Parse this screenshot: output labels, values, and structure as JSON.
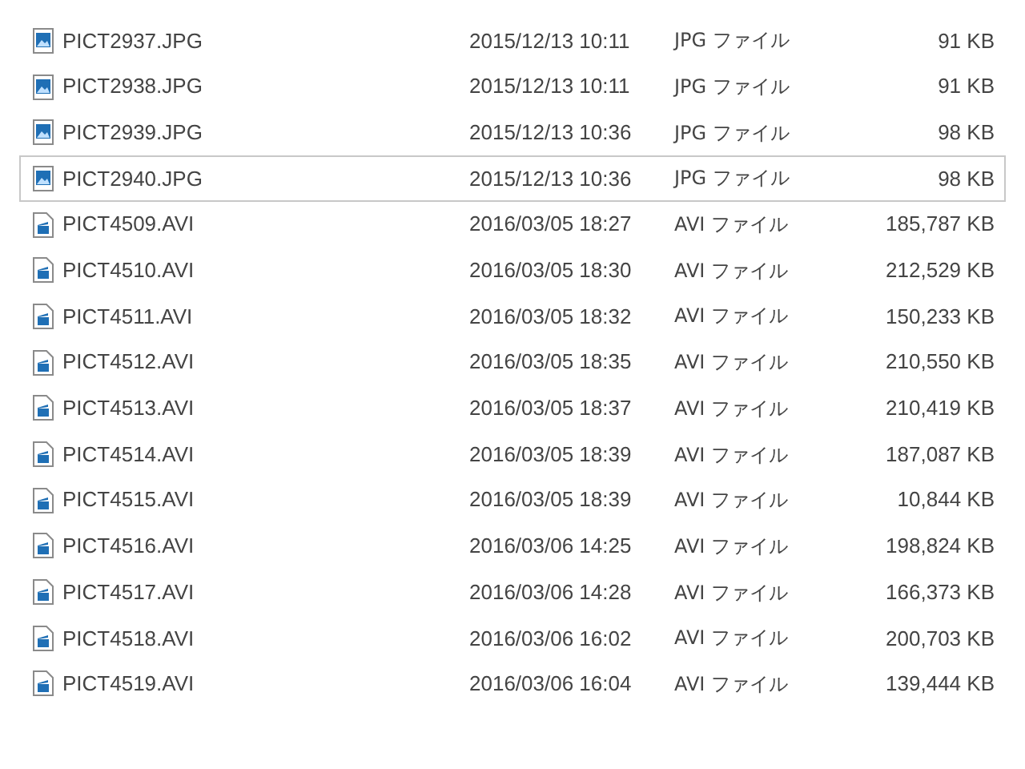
{
  "files": [
    {
      "kind": "image",
      "name": "PICT2937.JPG",
      "date": "2015/12/13 10:11",
      "type": "JPG ファイル",
      "size": "91 KB",
      "selected": false
    },
    {
      "kind": "image",
      "name": "PICT2938.JPG",
      "date": "2015/12/13 10:11",
      "type": "JPG ファイル",
      "size": "91 KB",
      "selected": false
    },
    {
      "kind": "image",
      "name": "PICT2939.JPG",
      "date": "2015/12/13 10:36",
      "type": "JPG ファイル",
      "size": "98 KB",
      "selected": false
    },
    {
      "kind": "image",
      "name": "PICT2940.JPG",
      "date": "2015/12/13 10:36",
      "type": "JPG ファイル",
      "size": "98 KB",
      "selected": true
    },
    {
      "kind": "video",
      "name": "PICT4509.AVI",
      "date": "2016/03/05 18:27",
      "type": "AVI ファイル",
      "size": "185,787 KB",
      "selected": false
    },
    {
      "kind": "video",
      "name": "PICT4510.AVI",
      "date": "2016/03/05 18:30",
      "type": "AVI ファイル",
      "size": "212,529 KB",
      "selected": false
    },
    {
      "kind": "video",
      "name": "PICT4511.AVI",
      "date": "2016/03/05 18:32",
      "type": "AVI ファイル",
      "size": "150,233 KB",
      "selected": false
    },
    {
      "kind": "video",
      "name": "PICT4512.AVI",
      "date": "2016/03/05 18:35",
      "type": "AVI ファイル",
      "size": "210,550 KB",
      "selected": false
    },
    {
      "kind": "video",
      "name": "PICT4513.AVI",
      "date": "2016/03/05 18:37",
      "type": "AVI ファイル",
      "size": "210,419 KB",
      "selected": false
    },
    {
      "kind": "video",
      "name": "PICT4514.AVI",
      "date": "2016/03/05 18:39",
      "type": "AVI ファイル",
      "size": "187,087 KB",
      "selected": false
    },
    {
      "kind": "video",
      "name": "PICT4515.AVI",
      "date": "2016/03/05 18:39",
      "type": "AVI ファイル",
      "size": "10,844 KB",
      "selected": false
    },
    {
      "kind": "video",
      "name": "PICT4516.AVI",
      "date": "2016/03/06 14:25",
      "type": "AVI ファイル",
      "size": "198,824 KB",
      "selected": false
    },
    {
      "kind": "video",
      "name": "PICT4517.AVI",
      "date": "2016/03/06 14:28",
      "type": "AVI ファイル",
      "size": "166,373 KB",
      "selected": false
    },
    {
      "kind": "video",
      "name": "PICT4518.AVI",
      "date": "2016/03/06 16:02",
      "type": "AVI ファイル",
      "size": "200,703 KB",
      "selected": false
    },
    {
      "kind": "video",
      "name": "PICT4519.AVI",
      "date": "2016/03/06 16:04",
      "type": "AVI ファイル",
      "size": "139,444 KB",
      "selected": false
    }
  ]
}
